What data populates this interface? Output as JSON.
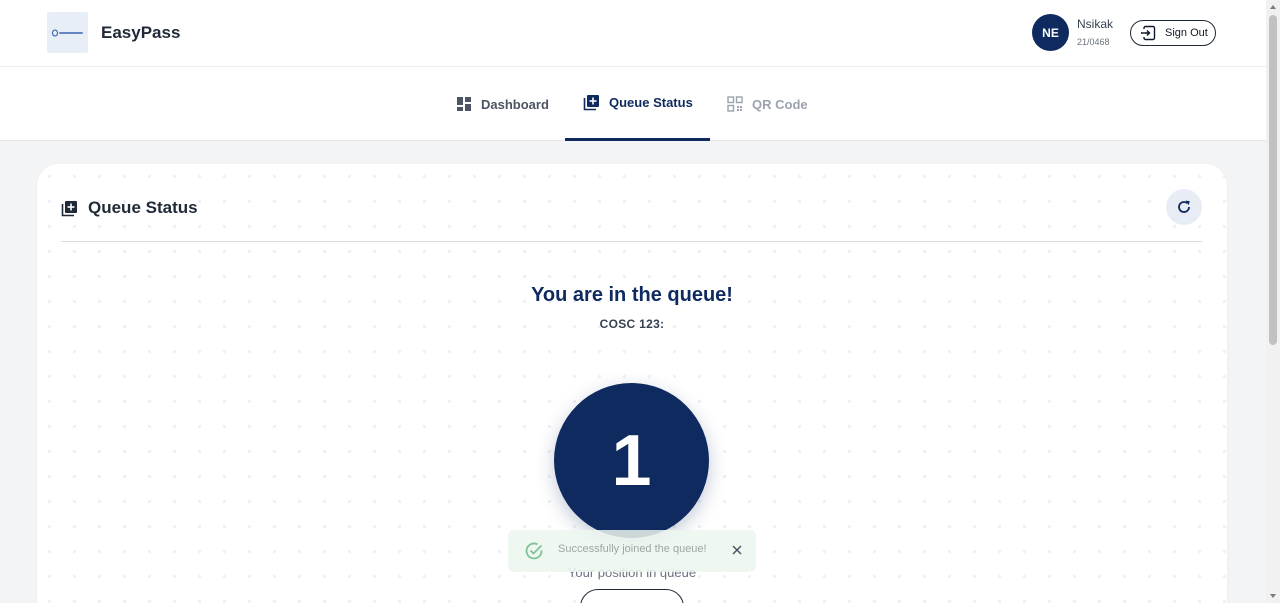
{
  "header": {
    "app_title": "EasyPass",
    "logo_icon": "easypass-logo",
    "user": {
      "initials": "NE",
      "name": "Nsikak",
      "id": "21/0468"
    },
    "signout_label": "Sign Out"
  },
  "tabs": [
    {
      "label": "Dashboard",
      "icon": "dashboard-icon",
      "active": false
    },
    {
      "label": "Queue Status",
      "icon": "queue-add-icon",
      "active": true
    },
    {
      "label": "QR Code",
      "icon": "qr-code-icon",
      "active": false
    }
  ],
  "card": {
    "title": "Queue Status",
    "headline": "You are in the queue!",
    "course": "COSC 123:",
    "position": "1",
    "position_label": "Your position in queue"
  },
  "toast": {
    "message": "Successfully joined the queue!",
    "status": "success"
  },
  "colors": {
    "primary": "#0f2a5f",
    "background": "#f3f4f6",
    "toast_bg": "#ecf6ee",
    "success": "#5cb87a"
  }
}
